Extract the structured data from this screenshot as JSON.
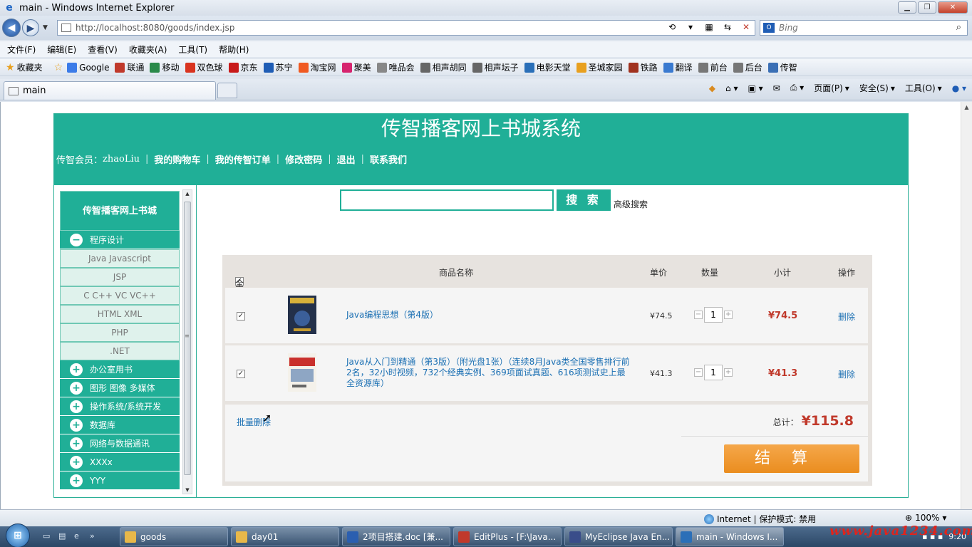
{
  "window": {
    "title": "main - Windows Internet Explorer",
    "url": "http://localhost:8080/goods/index.jsp",
    "search_placeholder": "Bing",
    "menu": [
      "文件(F)",
      "编辑(E)",
      "查看(V)",
      "收藏夹(A)",
      "工具(T)",
      "帮助(H)"
    ],
    "favorites_label": "收藏夹",
    "favorites": [
      {
        "label": "Google",
        "color": "#3b7be8"
      },
      {
        "label": "联通",
        "color": "#c0392b"
      },
      {
        "label": "移动",
        "color": "#2a8a4a"
      },
      {
        "label": "双色球",
        "color": "#d9341f"
      },
      {
        "label": "京东",
        "color": "#c81a1a"
      },
      {
        "label": "苏宁",
        "color": "#1f5db5"
      },
      {
        "label": "淘宝网",
        "color": "#f05a22"
      },
      {
        "label": "聚美",
        "color": "#d6246e"
      },
      {
        "label": "唯品会",
        "color": "#888888"
      },
      {
        "label": "相声胡同",
        "color": "#666666"
      },
      {
        "label": "相声坛子",
        "color": "#666666"
      },
      {
        "label": "电影天堂",
        "color": "#2a6fb8"
      },
      {
        "label": "圣城家园",
        "color": "#e8a01f"
      },
      {
        "label": "铁路",
        "color": "#a0321f"
      },
      {
        "label": "翻译",
        "color": "#3a7ad0"
      },
      {
        "label": "前台",
        "color": "#777777"
      },
      {
        "label": "后台",
        "color": "#777777"
      },
      {
        "label": "传智",
        "color": "#3a6fb5"
      }
    ],
    "tab_label": "main",
    "commands": [
      "页面(P)",
      "安全(S)",
      "工具(O)"
    ],
    "status_zone": "Internet | 保护模式: 禁用",
    "zoom": "100%"
  },
  "site": {
    "title": "传智播客网上书城系统",
    "member_prefix": "传智会员：",
    "member_name": "zhaoLiu",
    "nav": [
      "我的购物车",
      "我的传智订单",
      "修改密码",
      "退出",
      "联系我们"
    ]
  },
  "sidebar": {
    "heading": "传智播客网上书城",
    "expanded_category": "程序设计",
    "subcategories": [
      "Java Javascript",
      "JSP",
      "C C++ VC VC++",
      "HTML XML",
      "PHP",
      ".NET"
    ],
    "categories": [
      "办公室用书",
      "图形 图像 多媒体",
      "操作系统/系统开发",
      "数据库",
      "网络与数据通讯",
      "XXXx",
      "YYY"
    ]
  },
  "search": {
    "button": "搜 索",
    "advanced": "高级搜索"
  },
  "cart": {
    "select_all": "全选",
    "columns": {
      "name": "商品名称",
      "price": "单价",
      "qty": "数量",
      "subtotal": "小计",
      "action": "操作"
    },
    "items": [
      {
        "name": "Java编程思想（第4版）",
        "price": "¥74.5",
        "qty": "1",
        "subtotal": "¥74.5",
        "action": "删除",
        "checked": true
      },
      {
        "name": "Java从入门到精通（第3版）（附光盘1张）（连续8月Java类全国零售排行前2名，32小时视频，732个经典实例、369项面试真题、616项测试史上最全资源库）",
        "price": "¥41.3",
        "qty": "1",
        "subtotal": "¥41.3",
        "action": "删除",
        "checked": true
      }
    ],
    "bulk_delete": "批量删除",
    "total_label": "总计：",
    "total": "¥115.8",
    "checkout": "结算"
  },
  "taskbar": {
    "tasks": [
      "goods",
      "day01",
      "2项目搭建.doc [兼...",
      "EditPlus - [F:\\Java...",
      "MyEclipse Java En...",
      "main - Windows I..."
    ],
    "clock": "9:20",
    "watermark": "www.java1234.com"
  }
}
